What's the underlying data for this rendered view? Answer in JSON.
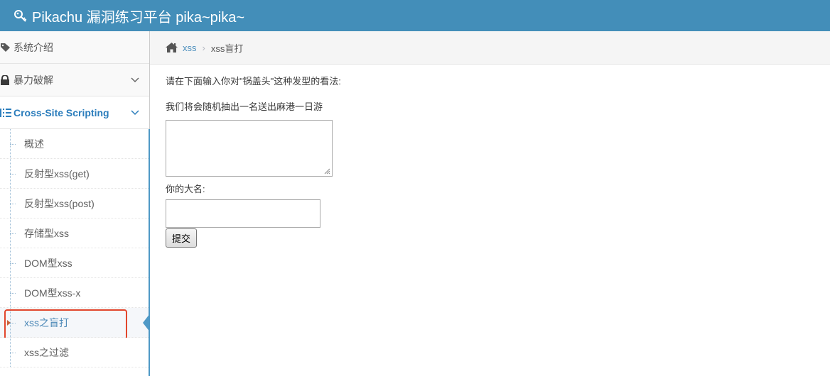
{
  "navbar": {
    "title": "Pikachu 漏洞练习平台 pika~pika~",
    "icon": "key-icon"
  },
  "sidebar": {
    "items": [
      {
        "label": "系统介绍",
        "icon": "tags-icon"
      },
      {
        "label": "暴力破解",
        "icon": "lock-icon"
      },
      {
        "label": "Cross-Site Scripting",
        "icon": "list-icon"
      }
    ],
    "submenu": [
      {
        "label": "概述"
      },
      {
        "label": "反射型xss(get)"
      },
      {
        "label": "反射型xss(post)"
      },
      {
        "label": "存储型xss"
      },
      {
        "label": "DOM型xss"
      },
      {
        "label": "DOM型xss-x"
      },
      {
        "label": "xss之盲打"
      },
      {
        "label": "xss之过滤"
      }
    ]
  },
  "breadcrumb": {
    "home_icon": "home-icon",
    "link": "xss",
    "separator": "›",
    "current": "xss盲打"
  },
  "main": {
    "prompt_line1": "请在下面输入你对\"锅盖头\"这种发型的看法:",
    "prompt_line2": "我们将会随机抽出一名送出麻港一日游",
    "opinion_value": "",
    "name_label": "你的大名:",
    "name_value": "",
    "submit_label": "提交"
  },
  "colors": {
    "navbar_bg": "#438eb9",
    "accent": "#2b7dbc",
    "highlight_box": "#e2462c"
  }
}
